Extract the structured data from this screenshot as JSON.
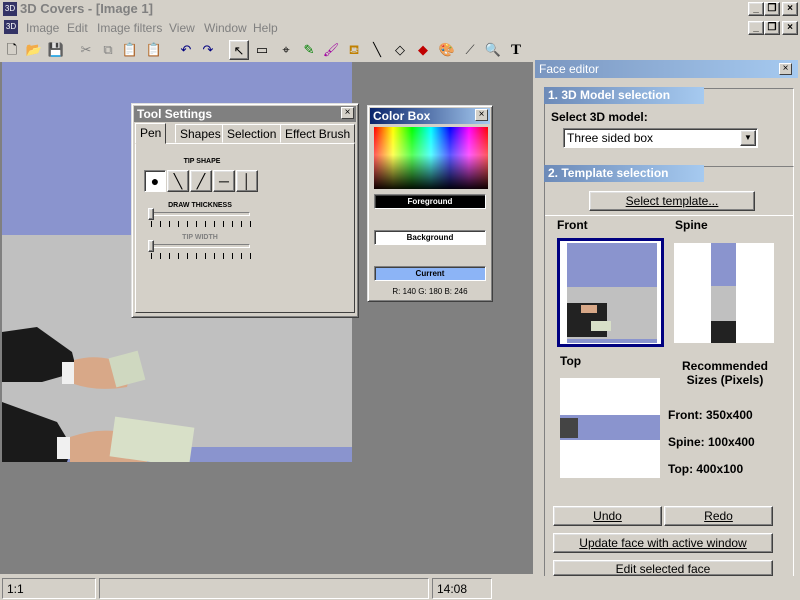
{
  "app": {
    "title": "3D Covers - [Image  1]"
  },
  "menu": {
    "items": [
      "Image",
      "Edit",
      "Image filters",
      "View",
      "Window",
      "Help"
    ]
  },
  "tool_settings": {
    "title": "Tool Settings",
    "tabs": [
      "Pen",
      "Shapes",
      "Selection",
      "Effect Brush"
    ],
    "tip_shape_label": "TIP SHAPE",
    "draw_thickness_label": "DRAW THICKNESS",
    "tip_width_label": "TIP WIDTH"
  },
  "color_box": {
    "title": "Color Box",
    "foreground_label": "Foreground",
    "background_label": "Background",
    "current_label": "Current",
    "rgb_readout": "R: 140  G: 180  B: 246",
    "colors": {
      "foreground": "#000000",
      "background": "#ffffff",
      "current": "#8cb4f6"
    }
  },
  "face_editor": {
    "title": "Face editor",
    "section1_title": "1. 3D Model selection",
    "select_model_label": "Select 3D model:",
    "model_value": "Three sided box",
    "section2_title": "2. Template selection",
    "select_template_button": "Select template...",
    "front_label": "Front",
    "spine_label": "Spine",
    "top_label": "Top",
    "recommended_title": "Recommended Sizes (Pixels)",
    "front_size": "Front: 350x400",
    "spine_size": "Spine: 100x400",
    "top_size": "Top: 400x100",
    "undo_button": "Undo",
    "redo_button": "Redo",
    "update_button": "Update face with active window",
    "edit_button": "Edit selected face"
  },
  "status": {
    "zoom": "1:1",
    "time": "14:08"
  },
  "colors": {
    "accent": "#8a94ce",
    "caption_active": "#0a246a",
    "caption_inactive": "#808080"
  }
}
